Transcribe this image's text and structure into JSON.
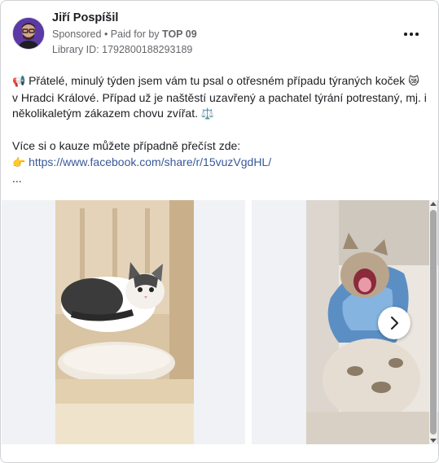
{
  "post": {
    "author": "Jiří Pospíšil",
    "sponsored": "Sponsored",
    "paid_prefix": " • Paid for by ",
    "paid_by": "TOP 09",
    "library_id": "Library ID: 1792800188293189",
    "more_icon": "more-horizontal-icon"
  },
  "body": {
    "emoji1": "📢",
    "line1": " Přátelé, minulý týden jsem vám tu psal o otřesném případu týraných koček ",
    "emoji2": "😿",
    "line2": "v Hradci Králové. Případ už je naštěstí uzavřený a pachatel týrání potrestaný, mj. i několikaletým zákazem chovu zvířat. ",
    "emoji3": "⚖️",
    "line3": "Více si o kauze můžete případně přečíst zde:",
    "emoji4": "👉",
    "link": "https://www.facebook.com/share/r/15vuzVgdHL/",
    "ellipsis": "..."
  },
  "carousel": {
    "next_icon": "chevron-right-icon",
    "images": [
      "kitten-lying-in-cat-bed",
      "cat-with-cone-yawning"
    ]
  }
}
